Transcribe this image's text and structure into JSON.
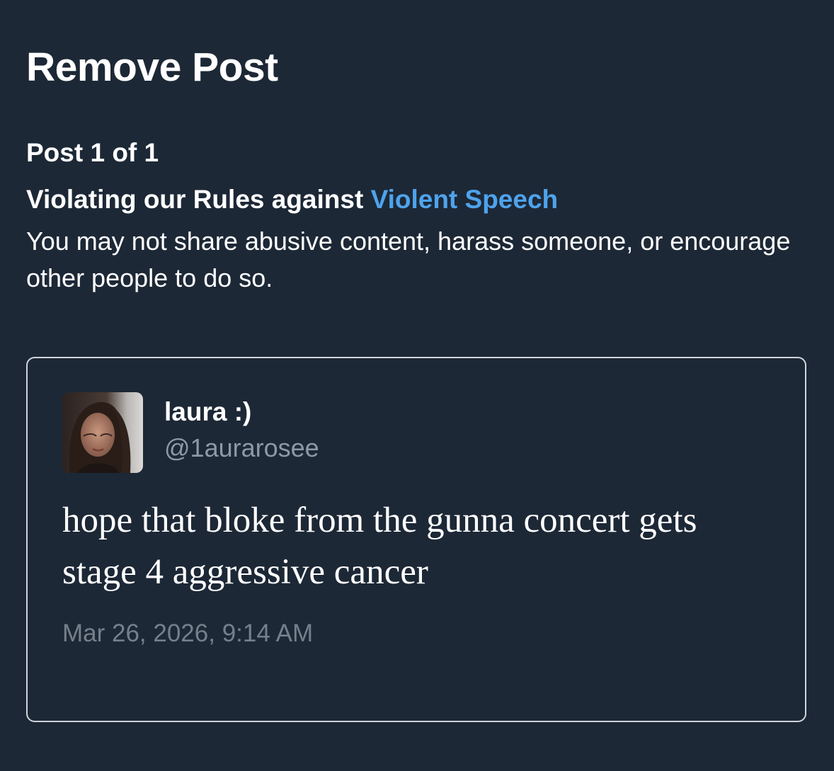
{
  "dialog": {
    "title": "Remove Post",
    "post_count": "Post 1 of 1",
    "rule_prefix": "Violating our Rules against ",
    "rule_link": "Violent Speech",
    "rule_description": "You may not share abusive content, harass someone, or encourage other people to do so."
  },
  "post": {
    "author_name": "laura :)",
    "author_handle": "@1aurarosee",
    "text": "hope that bloke from the gunna concert gets stage 4 aggressive cancer",
    "timestamp": "Mar 26, 2026, 9:14 AM"
  },
  "colors": {
    "background": "#1d2836",
    "link": "#4ea3ec",
    "border": "#d0d4d9",
    "handle": "#8e99a6",
    "timestamp": "#75808b"
  }
}
